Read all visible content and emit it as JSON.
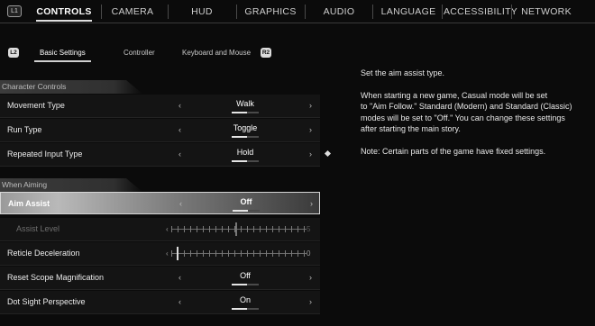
{
  "topnav": {
    "left_button": "L1",
    "tabs": [
      "CONTROLS",
      "CAMERA",
      "HUD",
      "GRAPHICS",
      "AUDIO",
      "LANGUAGE",
      "ACCESSIBILITY",
      "NETWORK"
    ],
    "active_tab": "CONTROLS"
  },
  "subtabs": {
    "left_icon": "L2",
    "right_icon": "R2",
    "tabs": [
      "Basic Settings",
      "Controller",
      "Keyboard and Mouse"
    ],
    "active": "Basic Settings"
  },
  "sections": {
    "character_controls": "Character Controls",
    "when_aiming": "When Aiming"
  },
  "arrows": {
    "left": "‹",
    "right": "›"
  },
  "settings": {
    "movement_type": {
      "label": "Movement Type",
      "value": "Walk"
    },
    "run_type": {
      "label": "Run Type",
      "value": "Toggle"
    },
    "repeated_input_type": {
      "label": "Repeated Input Type",
      "value": "Hold"
    },
    "aim_assist": {
      "label": "Aim Assist",
      "value": "Off"
    },
    "assist_level": {
      "label": "Assist Level",
      "value": "5",
      "max": 10,
      "level": 5
    },
    "reticle_deceleration": {
      "label": "Reticle Deceleration",
      "value": "0",
      "max": 10,
      "level": 0
    },
    "reset_scope_magnification": {
      "label": "Reset Scope Magnification",
      "value": "Off"
    },
    "dot_sight_perspective": {
      "label": "Dot Sight Perspective",
      "value": "On"
    }
  },
  "description": {
    "line1": "Set the aim assist type.",
    "line2": "When starting a new game, Casual mode will be set\nto \"Aim Follow.\" Standard (Modern) and Standard (Classic)\nmodes will be set to \"Off.\" You can change these settings\nafter starting the main story.",
    "line3": "Note: Certain parts of the game have fixed settings."
  },
  "colors": {
    "background": "#0b0b0b",
    "selected_row": "#b9b9b9",
    "text": "#e6e6e6"
  }
}
